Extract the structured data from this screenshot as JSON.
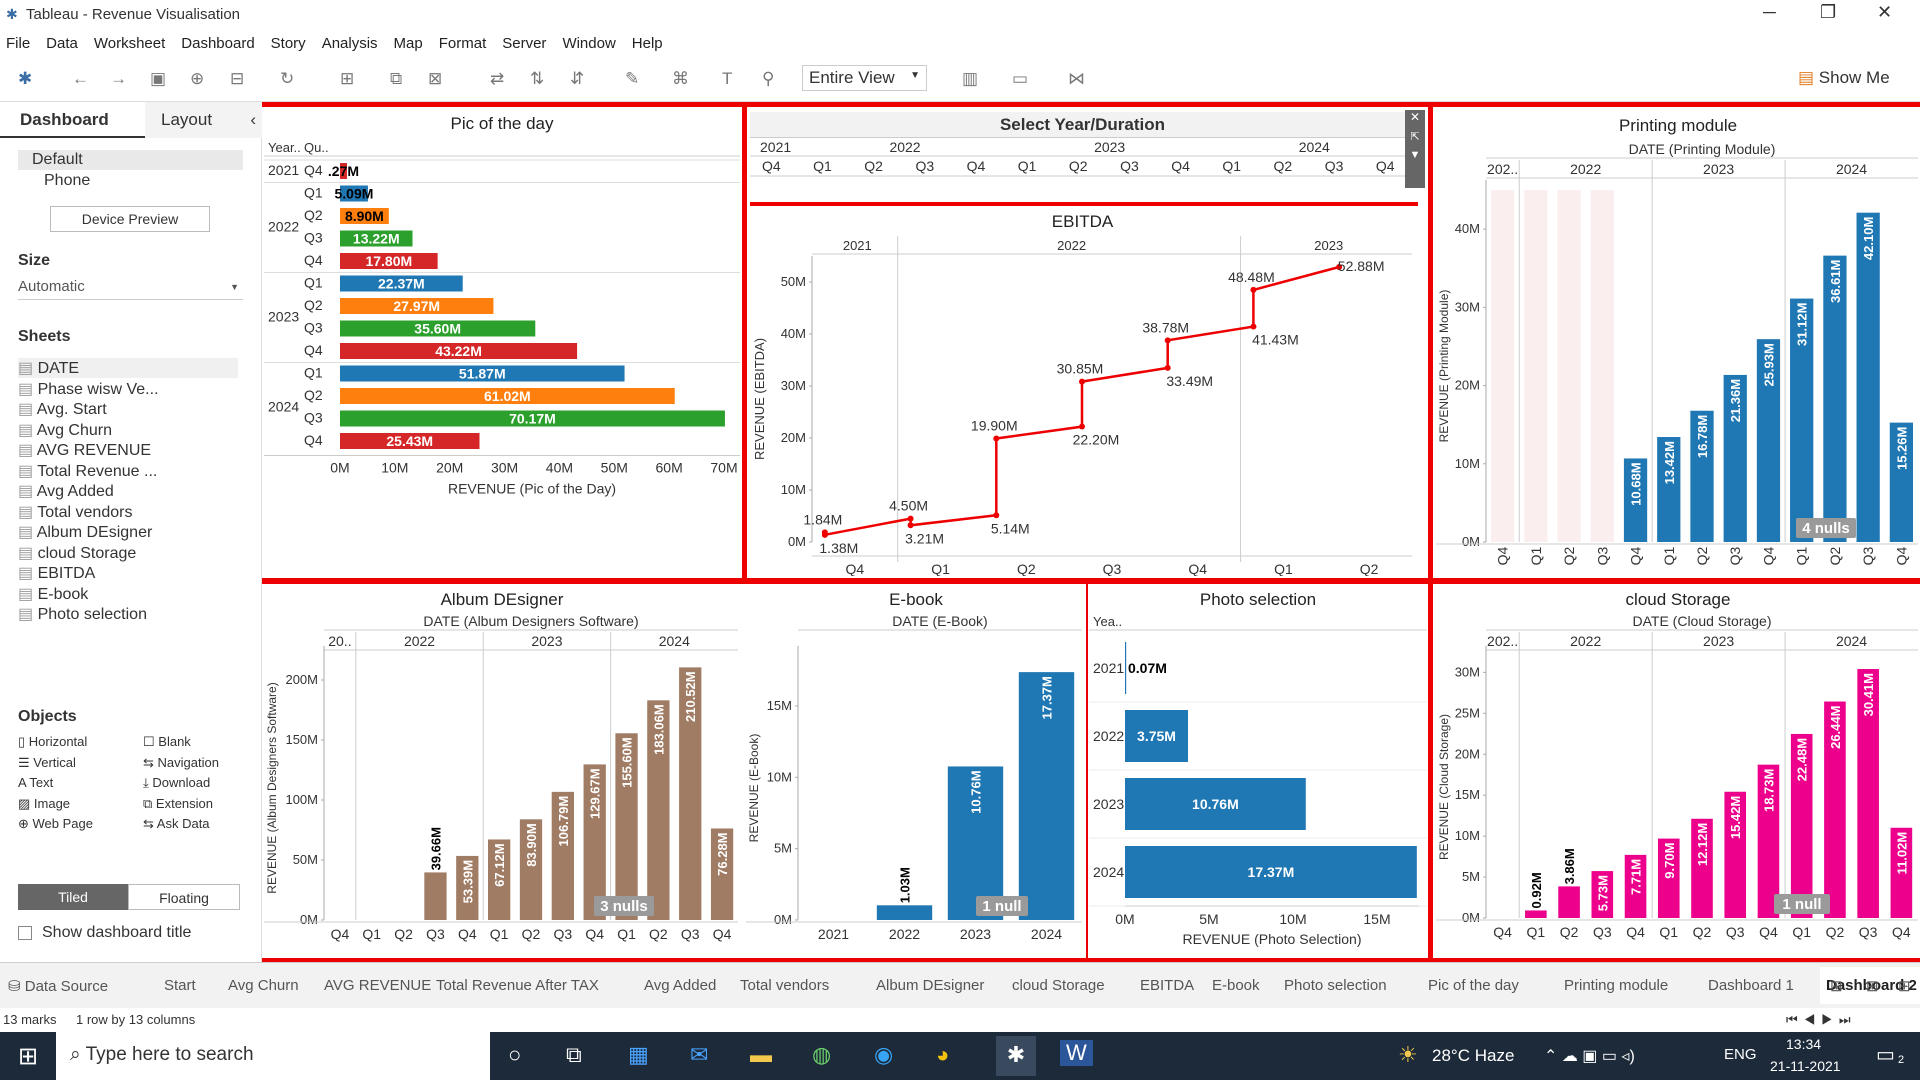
{
  "window": {
    "title": "Tableau - Revenue Visualisation"
  },
  "menu": [
    "File",
    "Data",
    "Worksheet",
    "Dashboard",
    "Story",
    "Analysis",
    "Map",
    "Format",
    "Server",
    "Window",
    "Help"
  ],
  "toolbar": {
    "fit": "Entire View",
    "show_me": "Show Me"
  },
  "side": {
    "tab_dashboard": "Dashboard",
    "tab_layout": "Layout",
    "device_default": "Default",
    "device_phone": "Phone",
    "device_preview": "Device Preview",
    "size_label": "Size",
    "size_value": "Automatic",
    "sheets_label": "Sheets",
    "sheets": [
      "DATE",
      "Phase wisw Ve...",
      "Avg. Start",
      "Avg Churn",
      "AVG REVENUE",
      "Total Revenue ...",
      "Avg Added",
      "Total  vendors",
      "Album DEsigner",
      "cloud Storage",
      "EBITDA",
      "E-book",
      "Photo selection"
    ],
    "objects_label": "Objects",
    "objects": [
      "Horizontal",
      "Blank",
      "Vertical",
      "Navigation",
      "Text",
      "Download",
      "Image",
      "Extension",
      "Web Page",
      "Ask Data"
    ],
    "tiled": "Tiled",
    "floating": "Floating",
    "show_title": "Show dashboard title"
  },
  "tabs": {
    "data_source": "Data Source",
    "items": [
      "Start",
      "Avg Churn",
      "AVG REVENUE",
      "Total Revenue After TAX",
      "Avg Added",
      "Total  vendors",
      "Album DEsigner",
      "cloud Storage",
      "EBITDA",
      "E-book",
      "Photo selection",
      "Pic of the day",
      "Printing module",
      "Dashboard 1",
      "Dashboard 2"
    ]
  },
  "status": {
    "marks": "13 marks",
    "dims": "1 row by 13 columns"
  },
  "taskbar": {
    "search": "Type here to search",
    "weather": "28°C  Haze",
    "lang": "ENG",
    "time": "13:34",
    "date": "21-11-2021",
    "notif": "2"
  },
  "colors": {
    "blue": "#1f77b4",
    "orange": "#ff7f0e",
    "green": "#2ca02c",
    "red": "#d62728",
    "brown": "#a07c64",
    "pink": "#ec008c",
    "dashred": "#ee0000"
  },
  "panels": {
    "pic_title": "Pic of the day",
    "pic_hdr_year": "Year..",
    "pic_hdr_q": "Qu..",
    "pic_xlabel": "REVENUE (Pic of the Day)",
    "select_title": "Select Year/Duration",
    "ebitda_title": "EBITDA",
    "ebitda_ylabel": "REVENUE (EBITDA)",
    "print_title": "Printing module",
    "print_date": "DATE (Printing Module)",
    "print_ylabel": "REVENUE (Printing Module)",
    "print_nulls": "4 nulls",
    "album_title": "Album DEsigner",
    "album_date": "DATE (Album Designers Software)",
    "album_ylabel": "REVENUE (Album Designers Software)",
    "album_nulls": "3 nulls",
    "ebook_title": "E-book",
    "ebook_date": "DATE (E-Book)",
    "ebook_ylabel": "REVENUE (E-Book)",
    "ebook_nulls": "1 null",
    "photo_title": "Photo selection",
    "photo_hdr": "Yea..",
    "photo_xlabel": "REVENUE (Photo Selection)",
    "cloud_title": "cloud Storage",
    "cloud_date": "DATE (Cloud Storage)",
    "cloud_ylabel": "REVENUE (Cloud Storage)",
    "cloud_nulls": "1 null"
  },
  "chart_data": [
    {
      "id": "pic",
      "type": "bar",
      "orientation": "horizontal",
      "title": "Pic of the day",
      "xlabel": "REVENUE (Pic of the Day)",
      "rows": [
        [
          "2021",
          "Q4",
          1.27,
          ".27M",
          "red"
        ],
        [
          "2022",
          "Q1",
          5.09,
          "5.09M",
          "blue"
        ],
        [
          "2022",
          "Q2",
          8.9,
          "8.90M",
          "orange"
        ],
        [
          "2022",
          "Q3",
          13.22,
          "13.22M",
          "green"
        ],
        [
          "2022",
          "Q4",
          17.8,
          "17.80M",
          "red"
        ],
        [
          "2023",
          "Q1",
          22.37,
          "22.37M",
          "blue"
        ],
        [
          "2023",
          "Q2",
          27.97,
          "27.97M",
          "orange"
        ],
        [
          "2023",
          "Q3",
          35.6,
          "35.60M",
          "green"
        ],
        [
          "2023",
          "Q4",
          43.22,
          "43.22M",
          "red"
        ],
        [
          "2024",
          "Q1",
          51.87,
          "51.87M",
          "blue"
        ],
        [
          "2024",
          "Q2",
          61.02,
          "61.02M",
          "orange"
        ],
        [
          "2024",
          "Q3",
          70.17,
          "70.17M",
          "green"
        ],
        [
          "2024",
          "Q4",
          25.43,
          "25.43M",
          "red"
        ]
      ],
      "xticks": [
        "0M",
        "10M",
        "20M",
        "30M",
        "40M",
        "50M",
        "60M",
        "70M"
      ],
      "xlim": [
        0,
        70
      ]
    },
    {
      "id": "select",
      "type": "table",
      "years": [
        "2021",
        "2022",
        "2023",
        "2024"
      ],
      "quarters": [
        "Q4",
        "Q1",
        "Q2",
        "Q3",
        "Q4",
        "Q1",
        "Q2",
        "Q3",
        "Q4",
        "Q1",
        "Q2",
        "Q3",
        "Q4"
      ]
    },
    {
      "id": "ebitda",
      "type": "line",
      "title": "EBITDA",
      "ylabel": "REVENUE (EBITDA)",
      "years": [
        "2021",
        "2022",
        "2023"
      ],
      "quarters": [
        "Q4",
        "Q1",
        "Q2",
        "Q3",
        "Q4",
        "Q1",
        "Q2"
      ],
      "segments": [
        [
          [
            1.84,
            1.38
          ],
          "1.84M",
          "1.38M"
        ],
        [
          [
            4.5,
            3.21
          ],
          "4.50M",
          "3.21M"
        ],
        [
          [
            5.14,
            19.9
          ],
          "5.14M",
          "19.90M"
        ],
        [
          [
            22.2,
            30.85
          ],
          "22.20M",
          "30.85M"
        ],
        [
          [
            33.49,
            38.78
          ],
          "33.49M",
          "38.78M"
        ],
        [
          [
            41.43,
            48.48
          ],
          "41.43M",
          "48.48M"
        ],
        [
          [
            52.88
          ],
          "52.88M",
          ""
        ]
      ],
      "yticks": [
        "0M",
        "10M",
        "20M",
        "30M",
        "40M",
        "50M"
      ],
      "ylim": [
        0,
        55
      ]
    },
    {
      "id": "print",
      "type": "bar",
      "title": "Printing module",
      "ylabel": "REVENUE (Printing Module)",
      "years": [
        "202..",
        "2022",
        "2023",
        "2024"
      ],
      "categories": [
        "Q4",
        "Q1",
        "Q2",
        "Q3",
        "Q4",
        "Q1",
        "Q2",
        "Q3",
        "Q4",
        "Q1",
        "Q2",
        "Q3",
        "Q4"
      ],
      "values": [
        null,
        null,
        null,
        null,
        10.68,
        13.42,
        16.78,
        21.36,
        25.93,
        31.12,
        36.61,
        42.1,
        15.26
      ],
      "labels": [
        "",
        "",
        "",
        "",
        "10.68M",
        "13.42M",
        "16.78M",
        "21.36M",
        "25.93M",
        "31.12M",
        "36.61M",
        "42.10M",
        "15.26M"
      ],
      "yticks": [
        "0M",
        "10M",
        "20M",
        "30M",
        "40M"
      ],
      "ylim": [
        0,
        45
      ],
      "color": "blue"
    },
    {
      "id": "album",
      "type": "bar",
      "title": "Album DEsigner",
      "ylabel": "REVENUE (Album Designers Software)",
      "years": [
        "20..",
        "2022",
        "2023",
        "2024"
      ],
      "categories": [
        "Q4",
        "Q1",
        "Q2",
        "Q3",
        "Q4",
        "Q1",
        "Q2",
        "Q3",
        "Q4",
        "Q1",
        "Q2",
        "Q3",
        "Q4"
      ],
      "values": [
        null,
        null,
        null,
        39.66,
        53.39,
        67.12,
        83.9,
        106.79,
        129.67,
        155.6,
        183.06,
        210.52,
        76.28
      ],
      "labels": [
        "",
        "",
        "",
        "39.66M",
        "53.39M",
        "67.12M",
        "83.90M",
        "106.79M",
        "129.67M",
        "155.60M",
        "183.06M",
        "210.52M",
        "76.28M"
      ],
      "yticks": [
        "0M",
        "50M",
        "100M",
        "150M",
        "200M"
      ],
      "ylim": [
        0,
        220
      ],
      "color": "brown"
    },
    {
      "id": "ebook",
      "type": "bar",
      "title": "E-book",
      "ylabel": "REVENUE (E-Book)",
      "categories": [
        "2021",
        "2022",
        "2023",
        "2024"
      ],
      "values": [
        null,
        1.03,
        10.76,
        17.37
      ],
      "labels": [
        "",
        "1.03M",
        "10.76M",
        "17.37M"
      ],
      "yticks": [
        "0M",
        "5M",
        "10M",
        "15M"
      ],
      "ylim": [
        0,
        18.5
      ],
      "color": "blue"
    },
    {
      "id": "photo",
      "type": "bar",
      "orientation": "horizontal",
      "title": "Photo selection",
      "xlabel": "REVENUE (Photo Selection)",
      "categories": [
        "2021",
        "2022",
        "2023",
        "2024"
      ],
      "values": [
        0.07,
        3.75,
        10.76,
        17.37
      ],
      "labels": [
        "0.07M",
        "3.75M",
        "10.76M",
        "17.37M"
      ],
      "xticks": [
        "0M",
        "5M",
        "10M",
        "15M"
      ],
      "xlim": [
        0,
        17.5
      ],
      "color": "blue"
    },
    {
      "id": "cloud",
      "type": "bar",
      "title": "cloud Storage",
      "ylabel": "REVENUE (Cloud Storage)",
      "years": [
        "202..",
        "2022",
        "2023",
        "2024"
      ],
      "categories": [
        "Q4",
        "Q1",
        "Q2",
        "Q3",
        "Q4",
        "Q1",
        "Q2",
        "Q3",
        "Q4",
        "Q1",
        "Q2",
        "Q3",
        "Q4"
      ],
      "values": [
        null,
        0.92,
        3.86,
        5.73,
        7.71,
        9.7,
        12.12,
        15.42,
        18.73,
        22.48,
        26.44,
        30.41,
        11.02
      ],
      "labels": [
        "",
        "0.92M",
        "3.86M",
        "5.73M",
        "7.71M",
        "9.70M",
        "12.12M",
        "15.42M",
        "18.73M",
        "22.48M",
        "26.44M",
        "30.41M",
        "11.02M"
      ],
      "yticks": [
        "0M",
        "5M",
        "10M",
        "15M",
        "20M",
        "25M",
        "30M"
      ],
      "ylim": [
        0,
        32
      ],
      "color": "pink"
    }
  ]
}
